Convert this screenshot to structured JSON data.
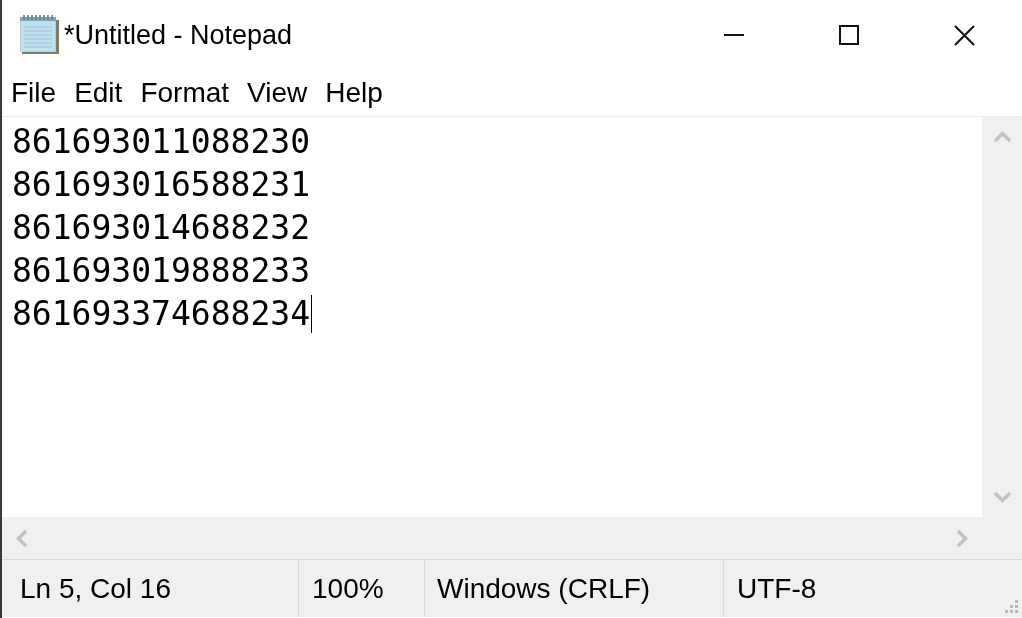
{
  "window": {
    "title": "*Untitled - Notepad"
  },
  "menu": [
    "File",
    "Edit",
    "Format",
    "View",
    "Help"
  ],
  "editor": {
    "lines": [
      "861693011088230",
      "861693016588231",
      "861693014688232",
      "861693019888233",
      "861693374688234"
    ]
  },
  "status_bar": [
    "Ln 5, Col 16",
    "100%",
    "Windows (CRLF)",
    "UTF-8"
  ]
}
